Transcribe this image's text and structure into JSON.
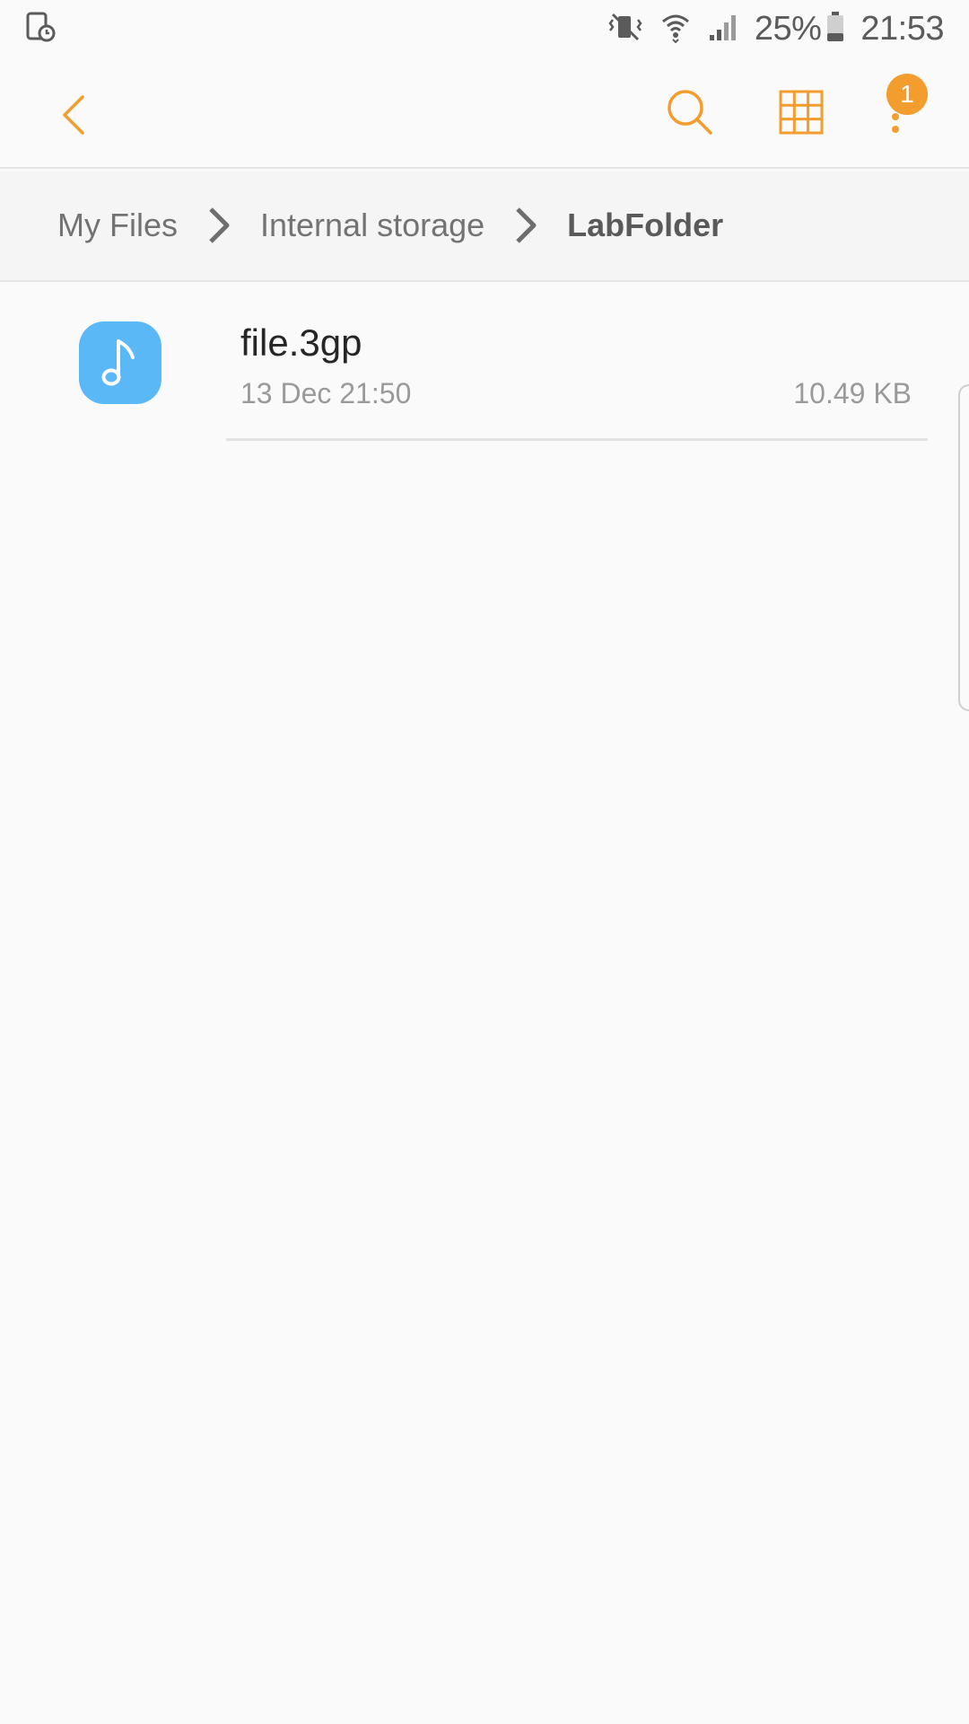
{
  "status_bar": {
    "battery_percent": "25%",
    "time": "21:53"
  },
  "breadcrumb": {
    "items": [
      "My Files",
      "Internal storage",
      "LabFolder"
    ]
  },
  "app_bar": {
    "more_badge_count": "1"
  },
  "files": [
    {
      "name": "file.3gp",
      "date": "13 Dec 21:50",
      "size": "10.49 KB",
      "icon": "music-note-icon"
    }
  ],
  "colors": {
    "accent": "#f29d2e",
    "file_icon_bg": "#5bb8f6"
  }
}
